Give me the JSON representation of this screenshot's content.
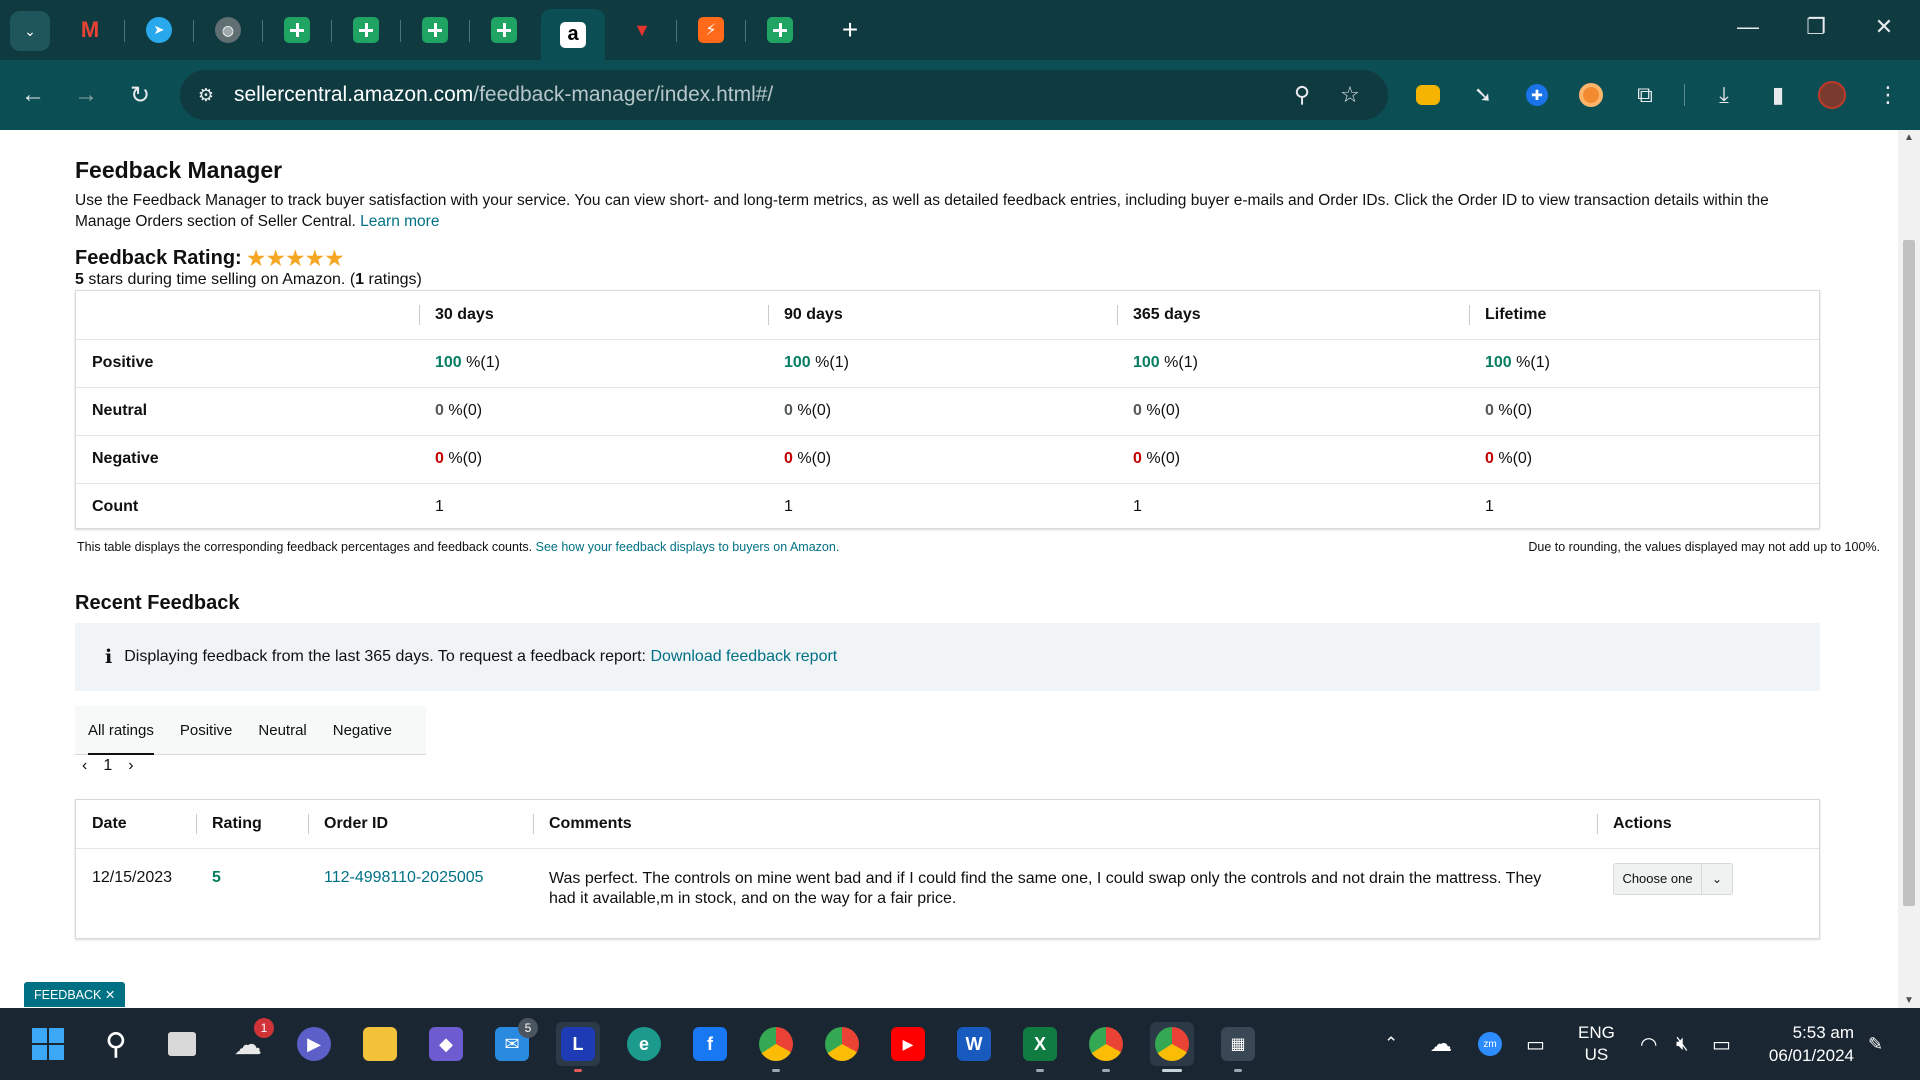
{
  "browser": {
    "url_host": "sellercentral.amazon.com",
    "url_path": "/feedback-manager/index.html#/",
    "tab_count_badge": "",
    "window_controls": [
      "minimize",
      "restore",
      "close"
    ]
  },
  "page": {
    "title": "Feedback Manager",
    "description": "Use the Feedback Manager to track buyer satisfaction with your service. You can view short- and long-term metrics, as well as detailed feedback entries, including buyer e-mails and Order IDs. Click the Order ID to view transaction details within the Manage Orders section of Seller Central.",
    "learn_more": "Learn more",
    "rating_label": "Feedback Rating:",
    "rating_stars": 5,
    "rating_summary_num": "5",
    "rating_summary_mid": "stars during time selling on Amazon. (",
    "rating_summary_count": "1",
    "rating_summary_end": "ratings)",
    "metrics": {
      "headers": [
        "30 days",
        "90 days",
        "365 days",
        "Lifetime"
      ],
      "rows": [
        {
          "label": "Positive",
          "cells": [
            {
              "v": "100",
              "s": "%(1)"
            },
            {
              "v": "100",
              "s": "%(1)"
            },
            {
              "v": "100",
              "s": "%(1)"
            },
            {
              "v": "100",
              "s": "%(1)"
            }
          ]
        },
        {
          "label": "Neutral",
          "cells": [
            {
              "v": "0",
              "s": "%(0)"
            },
            {
              "v": "0",
              "s": "%(0)"
            },
            {
              "v": "0",
              "s": "%(0)"
            },
            {
              "v": "0",
              "s": "%(0)"
            }
          ]
        },
        {
          "label": "Negative",
          "cells": [
            {
              "v": "0",
              "s": "%(0)"
            },
            {
              "v": "0",
              "s": "%(0)"
            },
            {
              "v": "0",
              "s": "%(0)"
            },
            {
              "v": "0",
              "s": "%(0)"
            }
          ]
        },
        {
          "label": "Count",
          "cells": [
            {
              "v": "1",
              "s": ""
            },
            {
              "v": "1",
              "s": ""
            },
            {
              "v": "1",
              "s": ""
            },
            {
              "v": "1",
              "s": ""
            }
          ]
        }
      ]
    },
    "note_left": "This table displays the corresponding feedback percentages and feedback counts.",
    "note_left_link": "See how your feedback displays to buyers on Amazon.",
    "note_right": "Due to rounding, the values displayed may not add up to 100%.",
    "recent_title": "Recent Feedback",
    "info_text": "Displaying feedback from the last 365 days. To request a feedback report:",
    "info_link": "Download feedback report",
    "filter_tabs": [
      "All ratings",
      "Positive",
      "Neutral",
      "Negative"
    ],
    "pager_page": "1",
    "feedback_headers": [
      "Date",
      "Rating",
      "Order ID",
      "Comments",
      "Actions"
    ],
    "feedback_rows": [
      {
        "date": "12/15/2023",
        "rating": "5",
        "order_id": "112-4998110-2025005",
        "comment": "Was perfect. The controls on mine went bad and if I could find the same one, I could swap only the controls and not drain the mattress. They had it available,m in stock, and on the way for a fair price.",
        "action": "Choose one"
      }
    ],
    "feedback_badge": "FEEDBACK"
  },
  "taskbar": {
    "weather_badge": "1",
    "mail_badge": "5",
    "lang_top": "ENG",
    "lang_bottom": "US",
    "time": "5:53 am",
    "date": "06/01/2024"
  },
  "colors": {
    "tabstrip": "#0e3a40",
    "toolbar": "#0b4f55",
    "link": "#007185",
    "positive": "#067d62",
    "negative": "#c40000",
    "star": "#f5a623"
  }
}
